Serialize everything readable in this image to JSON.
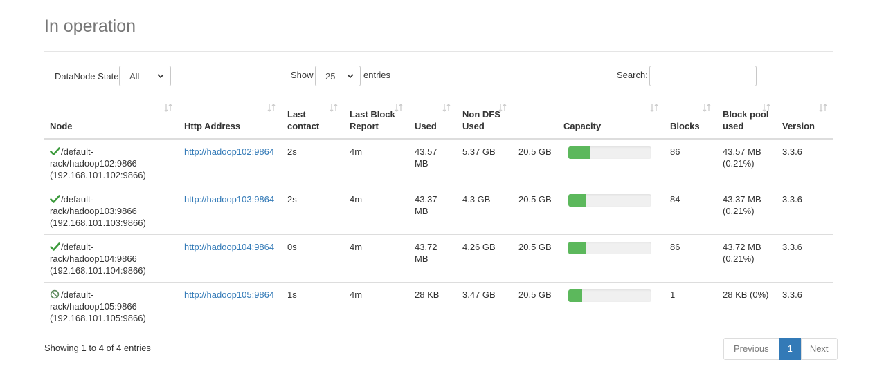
{
  "section_title": "In operation",
  "controls": {
    "state_label": "DataNode State",
    "state_value": "All",
    "show_label": "Show",
    "show_value": "25",
    "entries_label": "entries",
    "search_label": "Search:",
    "search_value": ""
  },
  "columns": [
    "Node",
    "Http Address",
    "Last contact",
    "Last Block Report",
    "Used",
    "Non DFS Used",
    "",
    "Capacity",
    "Blocks",
    "Block pool used",
    "Version"
  ],
  "rows": [
    {
      "status": "in-service",
      "status_icon": "check-icon",
      "node": "/default-rack/hadoop102:9866 (192.168.101.102:9866)",
      "http": "http://hadoop102:9864",
      "last_contact": "2s",
      "last_block_report": "4m",
      "used": "43.57 MB",
      "non_dfs_used": "5.37 GB",
      "capacity_total": "20.5 GB",
      "capacity_used_percent": 26,
      "blocks": "86",
      "block_pool_used": "43.57 MB (0.21%)",
      "version": "3.3.6"
    },
    {
      "status": "in-service",
      "status_icon": "check-icon",
      "node": "/default-rack/hadoop103:9866 (192.168.101.103:9866)",
      "http": "http://hadoop103:9864",
      "last_contact": "2s",
      "last_block_report": "4m",
      "used": "43.37 MB",
      "non_dfs_used": "4.3 GB",
      "capacity_total": "20.5 GB",
      "capacity_used_percent": 21,
      "blocks": "84",
      "block_pool_used": "43.37 MB (0.21%)",
      "version": "3.3.6"
    },
    {
      "status": "in-service",
      "status_icon": "check-icon",
      "node": "/default-rack/hadoop104:9866 (192.168.101.104:9866)",
      "http": "http://hadoop104:9864",
      "last_contact": "0s",
      "last_block_report": "4m",
      "used": "43.72 MB",
      "non_dfs_used": "4.26 GB",
      "capacity_total": "20.5 GB",
      "capacity_used_percent": 21,
      "blocks": "86",
      "block_pool_used": "43.72 MB (0.21%)",
      "version": "3.3.6"
    },
    {
      "status": "down",
      "status_icon": "ban-circle-icon",
      "node": "/default-rack/hadoop105:9866 (192.168.101.105:9866)",
      "http": "http://hadoop105:9864",
      "last_contact": "1s",
      "last_block_report": "4m",
      "used": "28 KB",
      "non_dfs_used": "3.47 GB",
      "capacity_total": "20.5 GB",
      "capacity_used_percent": 17,
      "blocks": "1",
      "block_pool_used": "28 KB (0%)",
      "version": "3.3.6"
    }
  ],
  "footer": {
    "info": "Showing 1 to 4 of 4 entries",
    "previous": "Previous",
    "page": "1",
    "next": "Next"
  },
  "colors": {
    "accent": "#337ab7",
    "bar_fill": "#5cb85c",
    "check": "#3c9a3c",
    "ban": "#5a8a5a"
  }
}
